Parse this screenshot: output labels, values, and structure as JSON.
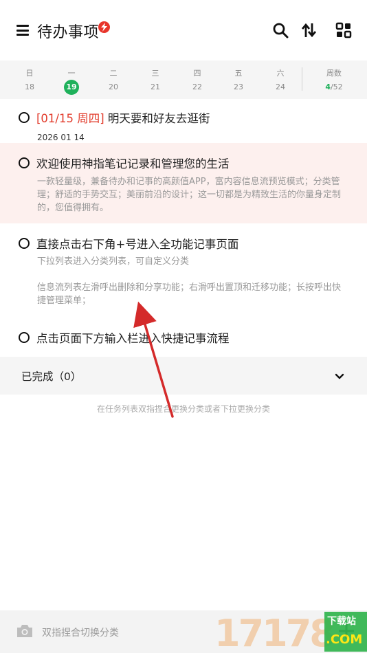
{
  "header": {
    "title": "待办事项",
    "icons": [
      "menu-icon",
      "flash-icon",
      "search-icon",
      "sort-icon",
      "grid-icon"
    ]
  },
  "week": {
    "days": [
      {
        "name": "日",
        "num": "18",
        "today": false
      },
      {
        "name": "一",
        "num": "19",
        "today": true
      },
      {
        "name": "二",
        "num": "20",
        "today": false
      },
      {
        "name": "三",
        "num": "21",
        "today": false
      },
      {
        "name": "四",
        "num": "22",
        "today": false
      },
      {
        "name": "五",
        "num": "23",
        "today": false
      },
      {
        "name": "六",
        "num": "24",
        "today": false
      }
    ],
    "week_label": "周数",
    "week_current": "4",
    "week_total": "/52"
  },
  "tasks": [
    {
      "date_tag": "[01/15 周四]",
      "title": "明天要和好友去逛街",
      "sub": "2026 01 14"
    },
    {
      "title": "欢迎使用神指笔记记录和管理您的生活",
      "desc": "一款轻量级，兼备待办和记事的高颜值APP，富内容信息流预览模式；分类管理；舒适的手势交互；美丽前沿的设计；这一切都是为精致生活的你量身定制的，您值得拥有。"
    },
    {
      "title": "直接点击右下角+号进入全功能记事页面",
      "desc_a": "下拉列表进入分类列表，可自定义分类",
      "desc_b": "信息流列表左滑呼出删除和分享功能；右滑呼出置顶和迁移功能；长按呼出快捷管理菜单；"
    },
    {
      "title": "点击页面下方输入栏进入快捷记事流程"
    }
  ],
  "completed": {
    "label": "已完成（0）"
  },
  "hint": "在任务列表双指捏合更换分类或者下拉更换分类",
  "bottom": {
    "placeholder": "双指捏合切换分类"
  },
  "watermark": {
    "digits": "17178",
    "top": "下载站",
    "bottom": ".COM"
  },
  "colors": {
    "accent_green": "#1fb15b",
    "date_red": "#e23b2b",
    "highlight_bg": "#fdf0ee",
    "annotation_arrow": "#d42a2a"
  }
}
